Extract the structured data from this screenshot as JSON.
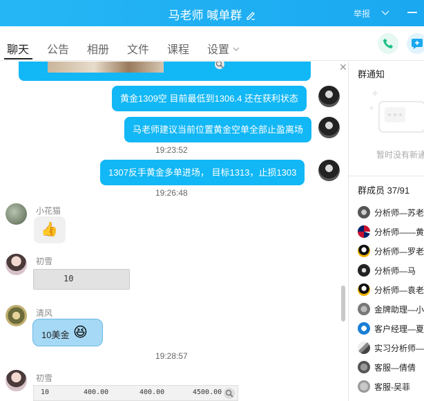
{
  "window": {
    "title": "马老师 喊单群",
    "report_label": "举报"
  },
  "tabs": [
    {
      "label": "聊天"
    },
    {
      "label": "公告"
    },
    {
      "label": "相册"
    },
    {
      "label": "文件"
    },
    {
      "label": "课程"
    },
    {
      "label": "设置"
    }
  ],
  "messages": {
    "m1": "黄金1309空 目前最低到1306.4 还在获利状态",
    "m2": "马老师建议当前位置黄金空单全部止盈离场",
    "t1": "19:23:52",
    "m3": "1307反手黄金多单进场， 目标1313，止损1303",
    "t2": "19:26:48",
    "u1_name": "小花猫",
    "u2_name": "初雪",
    "u2_value": "10",
    "u3_name": "清风",
    "u3_text": "10美金",
    "t3": "19:28:57",
    "u4_name": "初雪",
    "u4_row": [
      "10",
      "400.00",
      "400.00",
      "4500.00"
    ]
  },
  "side": {
    "notice_title": "群通知",
    "notice_empty": "暂时没有新通知",
    "members_title": "群成员 37/91",
    "members": [
      {
        "name": "分析师—苏老师"
      },
      {
        "name": "分析师——黄老师"
      },
      {
        "name": "分析师—罗老师"
      },
      {
        "name": "分析师—马"
      },
      {
        "name": "分析师—袁老师"
      },
      {
        "name": "金牌助理—小"
      },
      {
        "name": "客户经理—夏"
      },
      {
        "name": "实习分析师—"
      },
      {
        "name": "客服—倩倩"
      },
      {
        "name": "客服-吴菲"
      }
    ]
  },
  "colors": {
    "accent": "#12b7f5",
    "titlebar": "#1aa8f0"
  }
}
